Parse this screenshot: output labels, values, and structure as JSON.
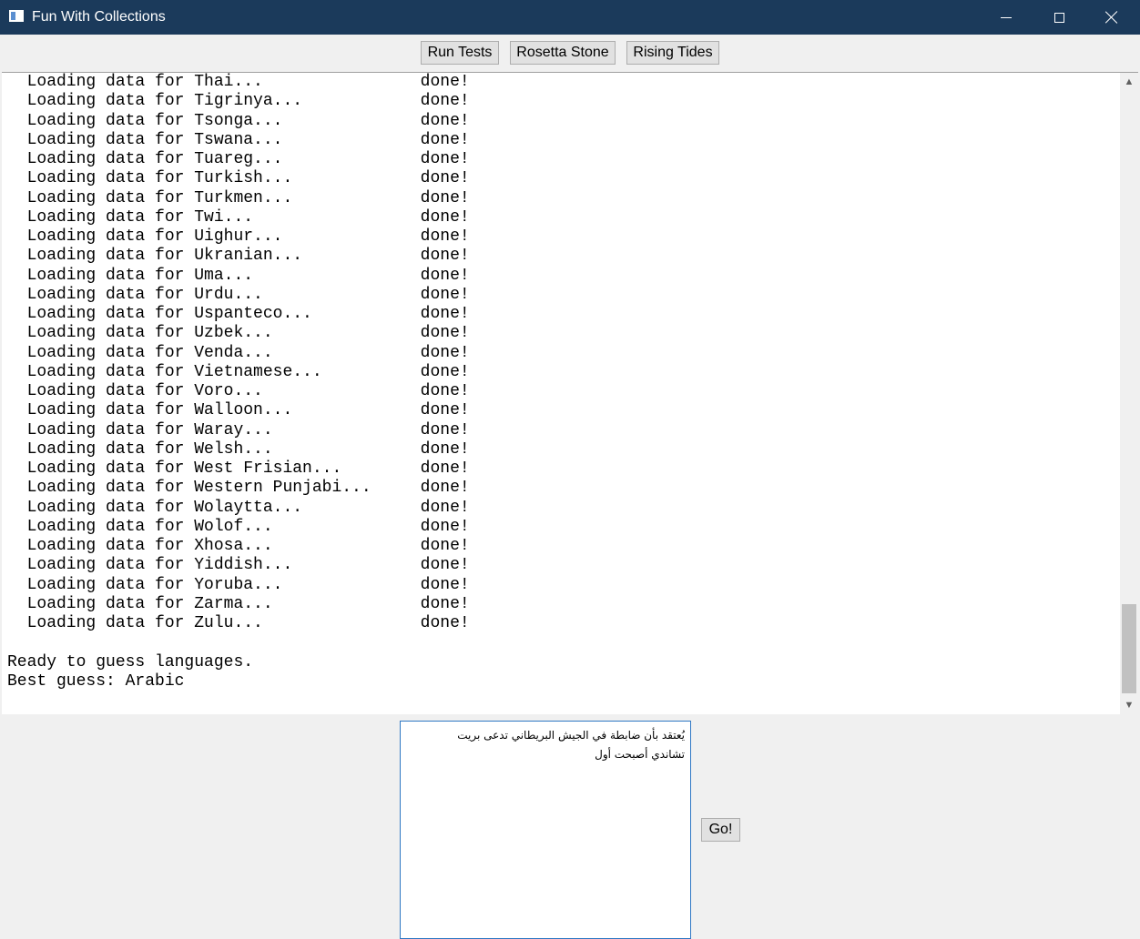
{
  "window": {
    "title": "Fun With Collections",
    "icon": "app-window-icon",
    "controls": {
      "minimize": "minimize-icon",
      "maximize": "maximize-icon",
      "close": "close-icon"
    }
  },
  "toolbar": {
    "run_tests": "Run Tests",
    "rosetta_stone": "Rosetta Stone",
    "rising_tides": "Rising Tides"
  },
  "output": {
    "lines": [
      "  Loading data for Thai...                done!",
      "  Loading data for Tigrinya...            done!",
      "  Loading data for Tsonga...              done!",
      "  Loading data for Tswana...              done!",
      "  Loading data for Tuareg...              done!",
      "  Loading data for Turkish...             done!",
      "  Loading data for Turkmen...             done!",
      "  Loading data for Twi...                 done!",
      "  Loading data for Uighur...              done!",
      "  Loading data for Ukranian...            done!",
      "  Loading data for Uma...                 done!",
      "  Loading data for Urdu...                done!",
      "  Loading data for Uspanteco...           done!",
      "  Loading data for Uzbek...               done!",
      "  Loading data for Venda...               done!",
      "  Loading data for Vietnamese...          done!",
      "  Loading data for Voro...                done!",
      "  Loading data for Walloon...             done!",
      "  Loading data for Waray...               done!",
      "  Loading data for Welsh...               done!",
      "  Loading data for West Frisian...        done!",
      "  Loading data for Western Punjabi...     done!",
      "  Loading data for Wolaytta...            done!",
      "  Loading data for Wolof...               done!",
      "  Loading data for Xhosa...               done!",
      "  Loading data for Yiddish...             done!",
      "  Loading data for Yoruba...              done!",
      "  Loading data for Zarma...               done!",
      "  Loading data for Zulu...                done!",
      "",
      "Ready to guess languages.",
      "Best guess: Arabic"
    ]
  },
  "scrollbar": {
    "up_icon": "chevron-up-icon",
    "down_icon": "chevron-down-icon"
  },
  "input": {
    "text": "يُعتقد بأن ضابطة في الجيش البريطاني تدعى بريت تشاندي أصبحت أول"
  },
  "go_button": {
    "label": "Go!"
  }
}
